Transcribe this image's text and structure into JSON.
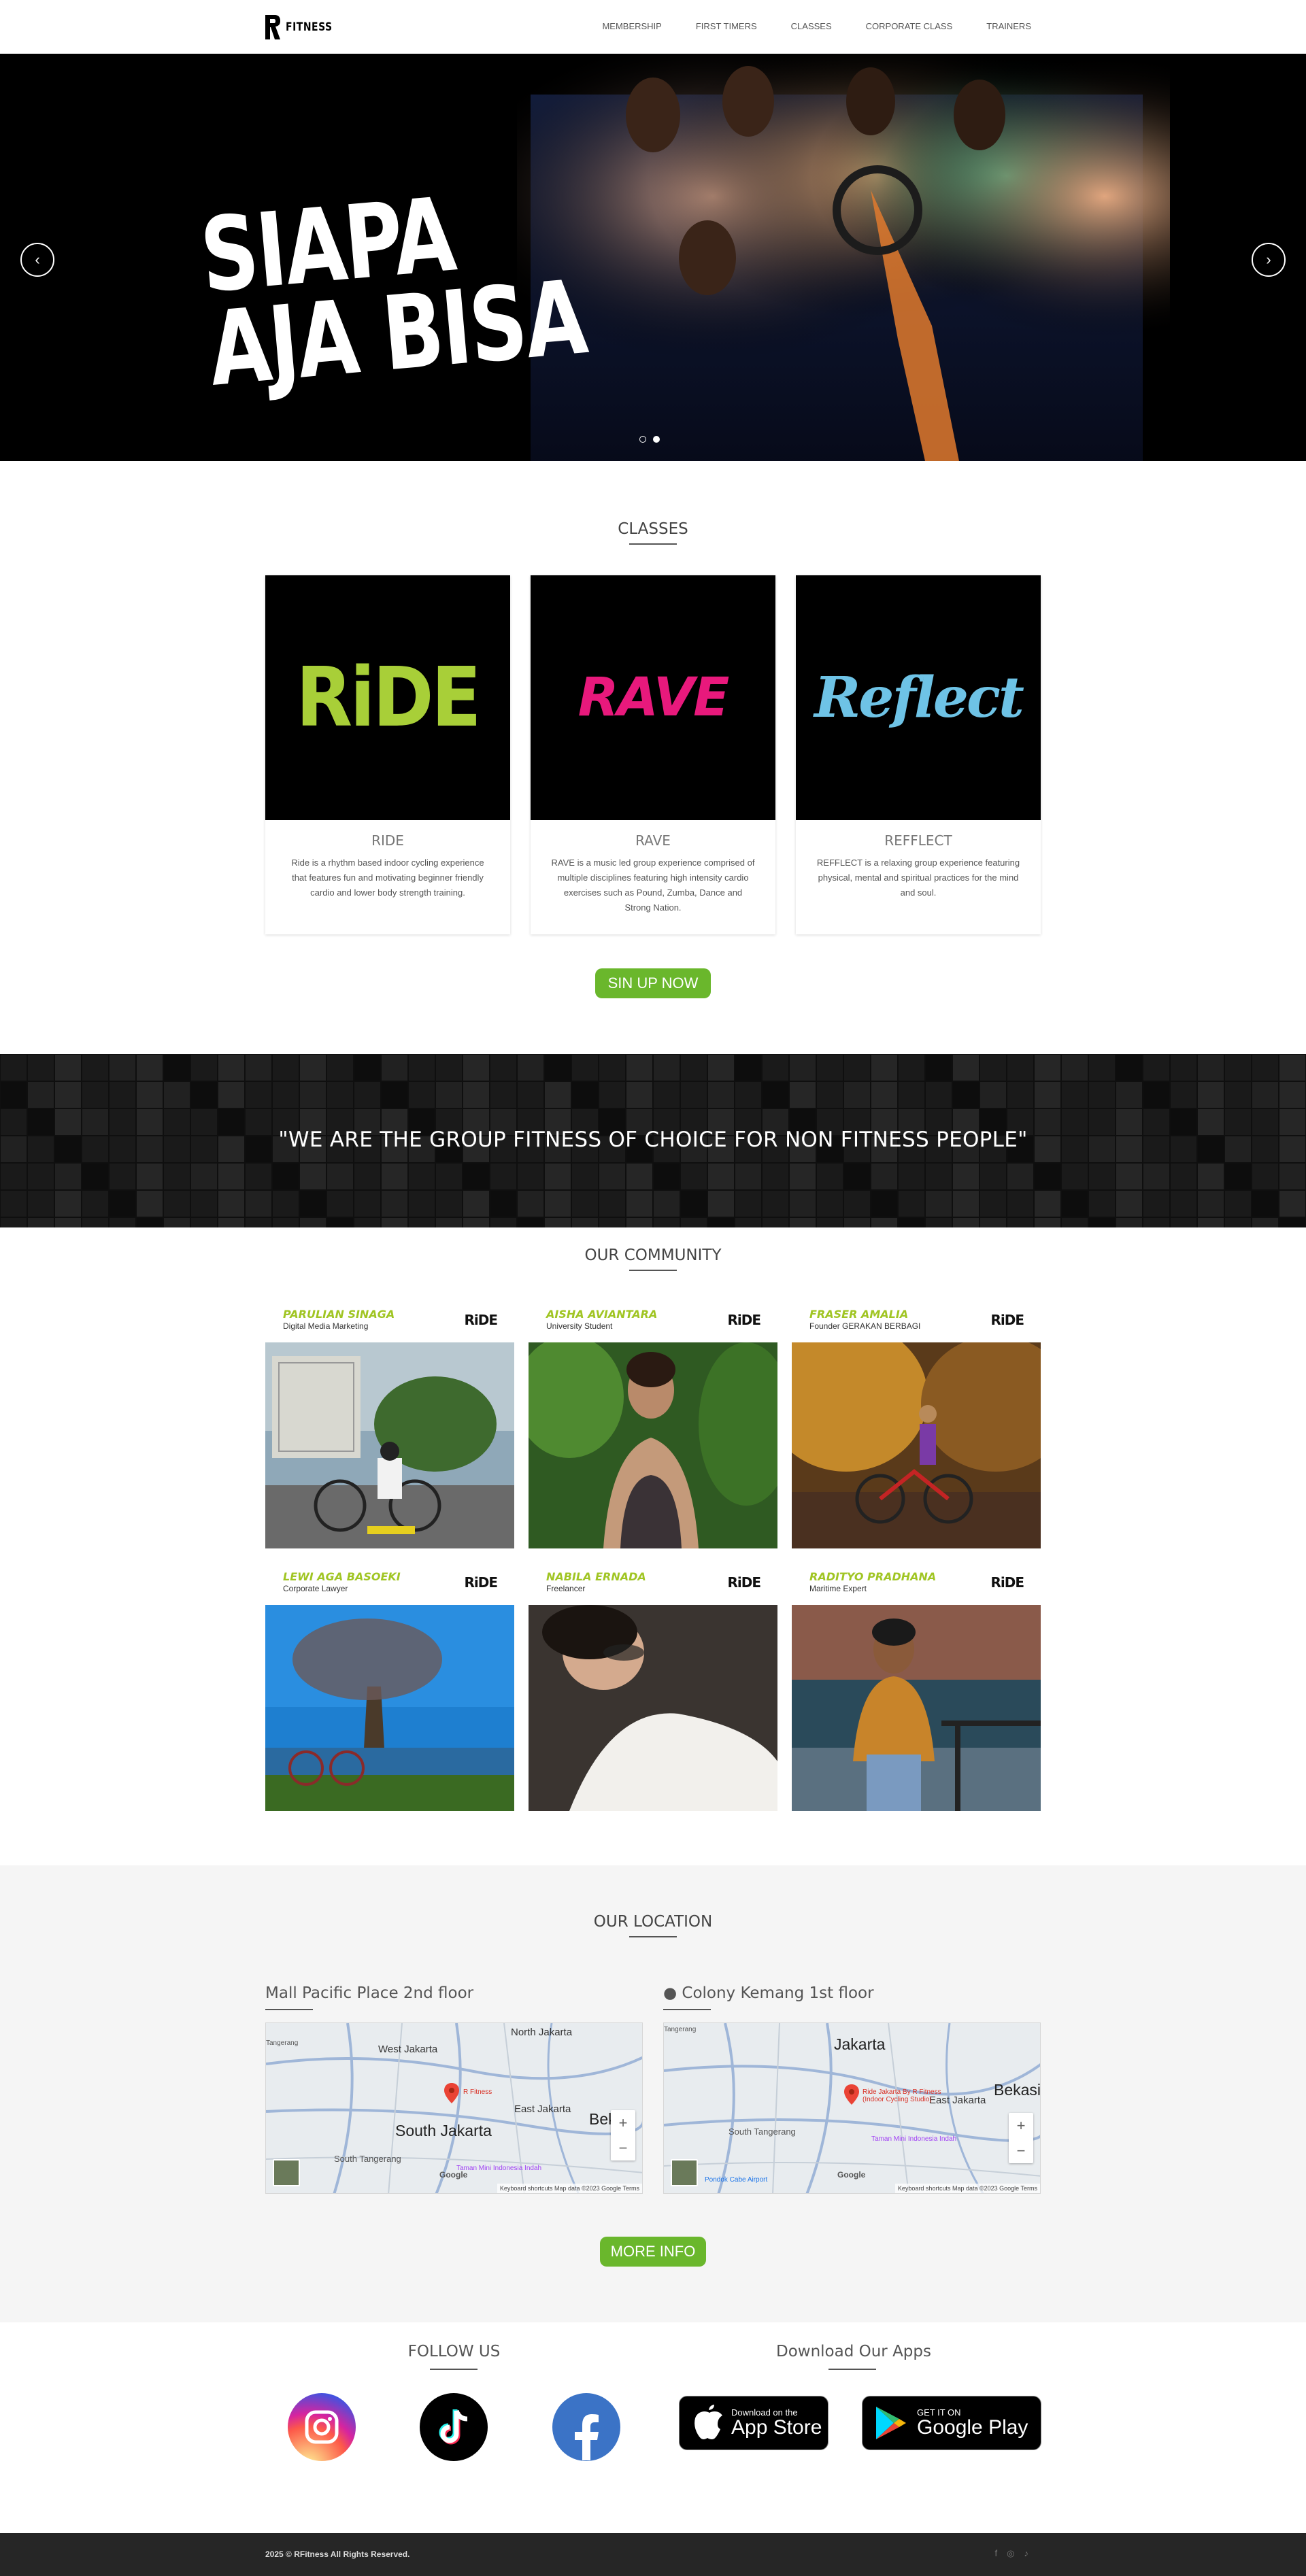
{
  "brand": {
    "logo_text": "FITNESS"
  },
  "nav": {
    "items": [
      {
        "label": "MEMBERSHIP"
      },
      {
        "label": "FIRST TIMERS"
      },
      {
        "label": "CLASSES"
      },
      {
        "label": "CORPORATE CLASS"
      },
      {
        "label": "TRAINERS"
      }
    ]
  },
  "hero": {
    "line1": "SIAPA",
    "line2": "AJA BISA",
    "prev_icon": "‹",
    "next_icon": "›",
    "slide_count": 2,
    "active_slide": 2
  },
  "classes": {
    "title": "CLASSES",
    "cards": [
      {
        "logo": "RiDE",
        "logo_color": "#a8cf38",
        "name": "RIDE",
        "desc": "Ride is a rhythm based indoor cycling experience that features fun and motivating beginner friendly cardio and lower body strength training."
      },
      {
        "logo": "RAVE",
        "logo_color": "#e8197c",
        "name": "RAVE",
        "desc": "RAVE is a music led group experience comprised of multiple disciplines featuring high intensity cardio exercises such as Pound, Zumba, Dance and Strong Nation."
      },
      {
        "logo": "Reflect",
        "logo_color": "#6ec3e6",
        "name": "REFFLECT",
        "desc": "REFFLECT is a relaxing group experience featuring physical, mental and spiritual practices for the mind and soul."
      }
    ],
    "cta": "SIN UP NOW"
  },
  "quote": {
    "text": "\"WE ARE THE GROUP FITNESS OF CHOICE FOR NON FITNESS PEOPLE\""
  },
  "community": {
    "title": "OUR COMMUNITY",
    "members": [
      {
        "name": "PARULIAN SINAGA",
        "job": "Digital Media Marketing",
        "brand": "RiDE"
      },
      {
        "name": "AISHA AVIANTARA",
        "job": "University Student",
        "brand": "RiDE"
      },
      {
        "name": "FRASER AMALIA",
        "job": "Founder GERAKAN BERBAGI",
        "brand": "RiDE"
      },
      {
        "name": "LEWI AGA BASOEKI",
        "job": "Corporate Lawyer",
        "brand": "RiDE"
      },
      {
        "name": "NABILA ERNADA",
        "job": "Freelancer",
        "brand": "RiDE"
      },
      {
        "name": "RADITYO PRADHANA",
        "job": "Maritime Expert",
        "brand": "RiDE"
      }
    ]
  },
  "location": {
    "title": "OUR LOCATION",
    "places": [
      {
        "title": "Mall Pacific Place 2nd floor",
        "labels": [
          "West Jakarta",
          "North Jakarta",
          "R Fitness",
          "East Jakarta",
          "South Jakarta",
          "Bekasi",
          "South Tangerang",
          "Taman Mini Indonesia Indah",
          "Tangerang"
        ],
        "footer": "Keyboard shortcuts   Map data ©2023 Google   Terms"
      },
      {
        "title": "● Colony Kemang 1st floor",
        "labels": [
          "Jakarta",
          "East Jakarta",
          "Ride Jakarta By R Fitness (Indoor Cycling Studio)",
          "Bekasi",
          "South Tangerang",
          "Taman Mini Indonesia Indah",
          "Pondok Cabe Airport",
          "Tangerang"
        ],
        "footer": "Keyboard shortcuts   Map data ©2023 Google   Terms"
      }
    ],
    "map_brand": "Google",
    "cta": "MORE INFO"
  },
  "follow": {
    "title": "FOLLOW US",
    "icons": [
      "instagram-icon",
      "tiktok-icon",
      "facebook-icon"
    ]
  },
  "apps": {
    "title": "Download Our Apps",
    "appstore_small": "Download on the",
    "appstore_big": "App Store",
    "play_small": "GET IT ON",
    "play_big": "Google Play"
  },
  "footer": {
    "copyright": "2025 © RFitness All Rights Reserved.",
    "icons": [
      "f",
      "◎",
      "♪"
    ]
  },
  "colors": {
    "accent_green": "#6ab72c",
    "footer_bg": "#262626",
    "name_green": "#a0c523"
  }
}
